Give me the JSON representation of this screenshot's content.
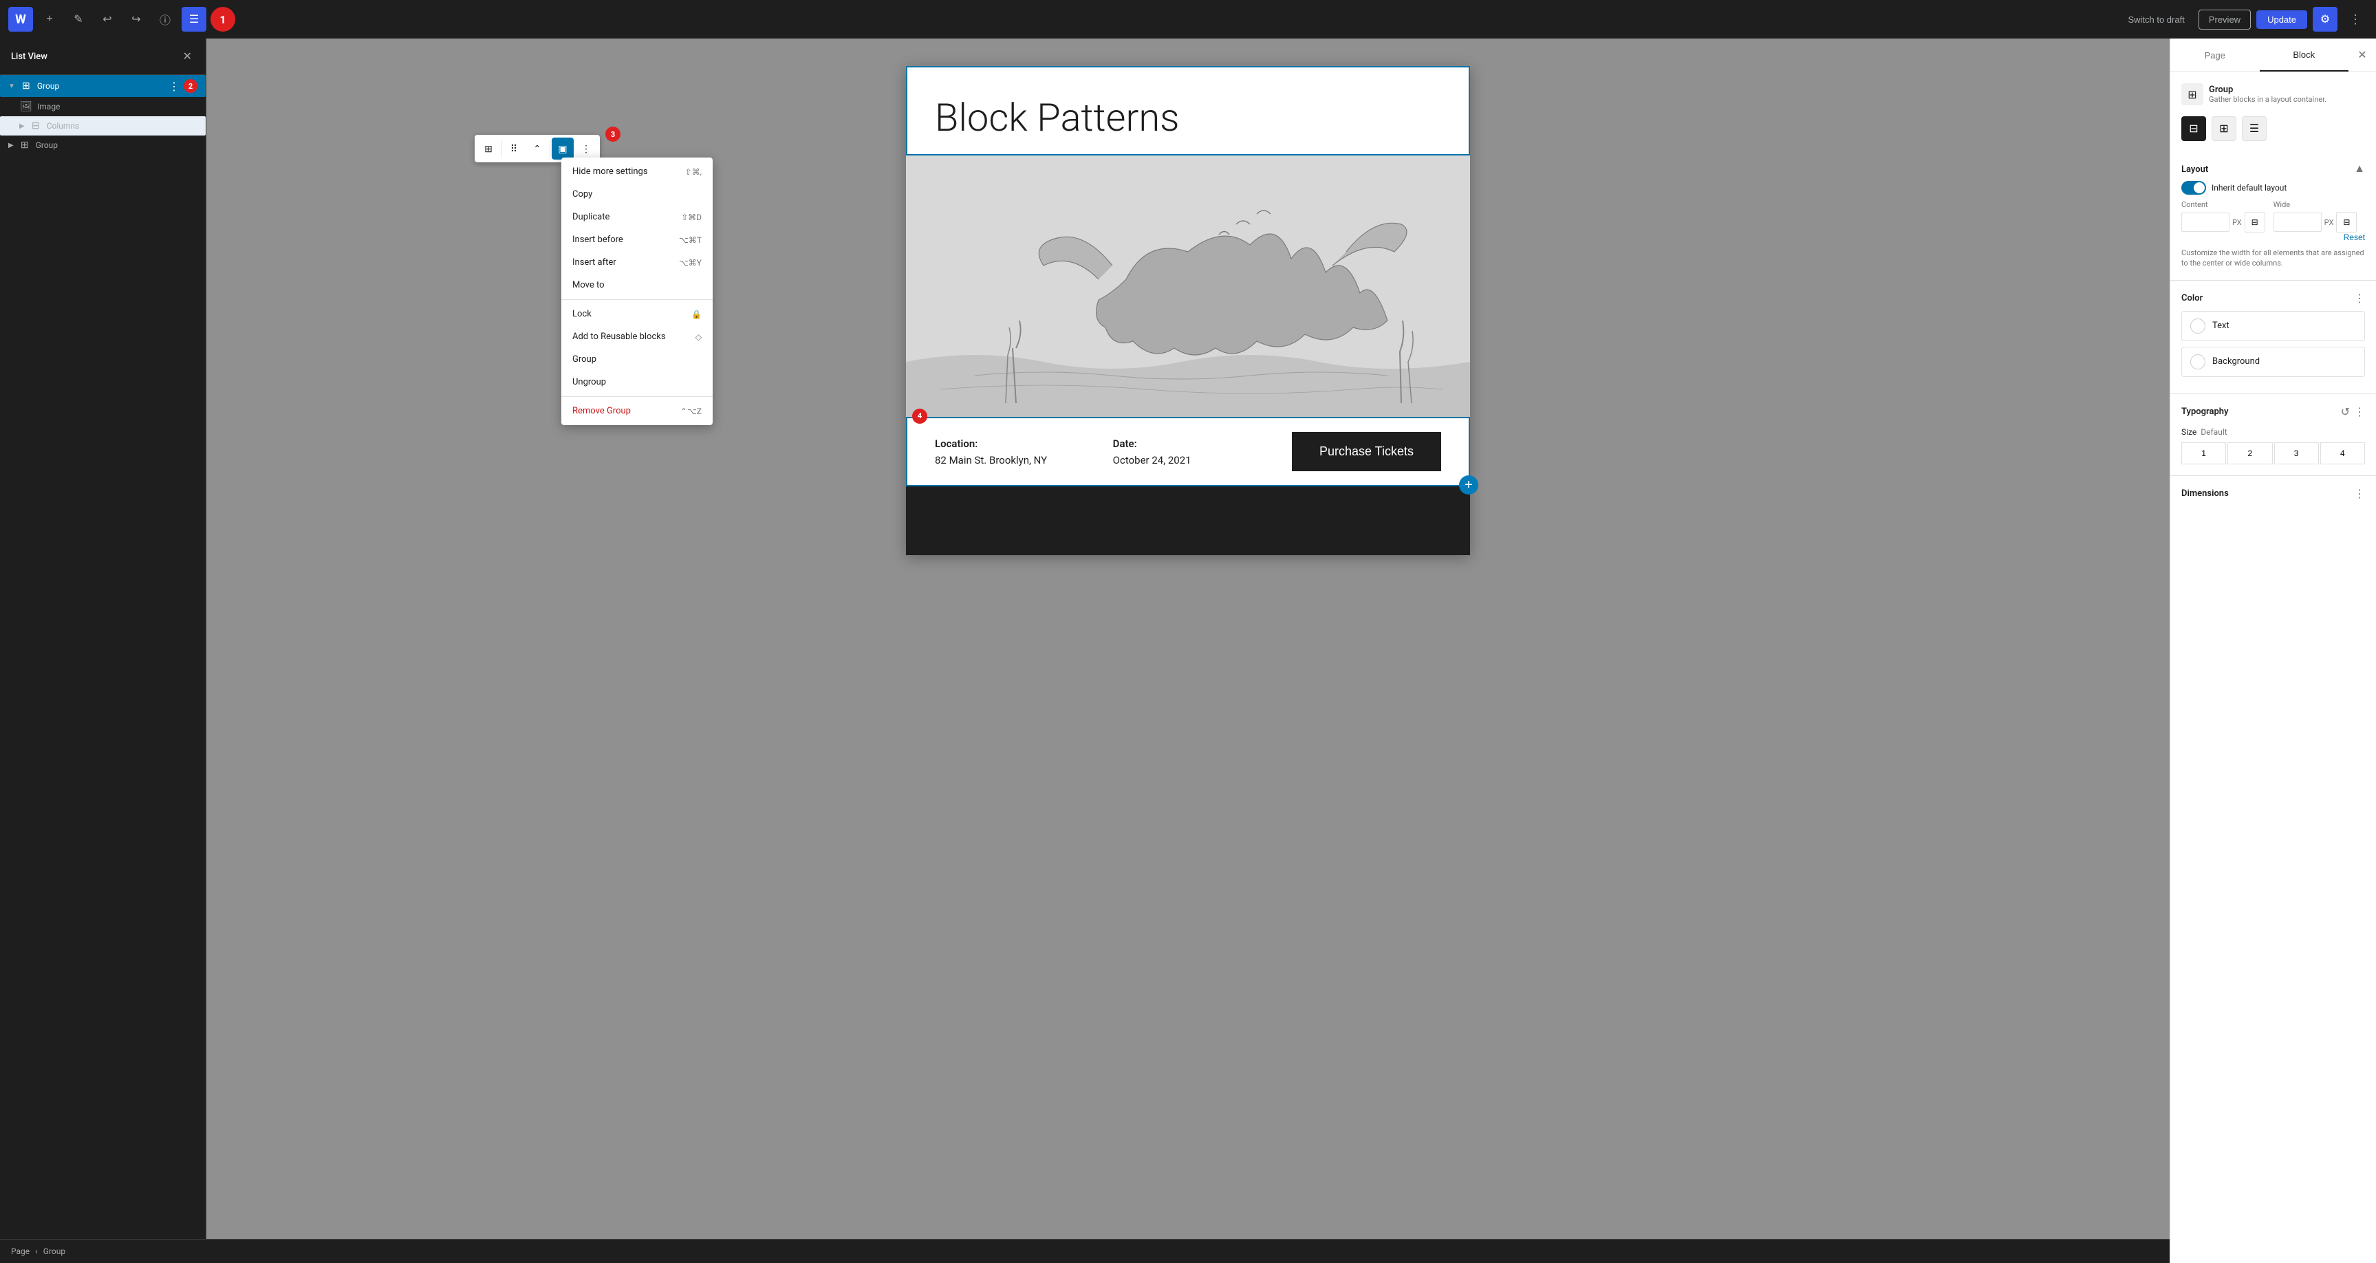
{
  "topbar": {
    "logo": "W",
    "switch_draft": "Switch to draft",
    "preview": "Preview",
    "update": "Update",
    "tools": [
      "+",
      "✏",
      "↩",
      "↪",
      "ⓘ",
      "≡"
    ]
  },
  "sidebar": {
    "title": "List View",
    "items": [
      {
        "id": "group",
        "label": "Group",
        "level": 0,
        "selected": true,
        "hasChevron": true,
        "icon": "⊞"
      },
      {
        "id": "image",
        "label": "Image",
        "level": 1,
        "selected": false,
        "icon": "🖼"
      },
      {
        "id": "columns",
        "label": "Columns",
        "level": 1,
        "selected": false,
        "icon": "⊟",
        "hasChevron": true
      },
      {
        "id": "group2",
        "label": "Group",
        "level": 0,
        "selected": false,
        "icon": "⊞",
        "hasChevron": true
      }
    ],
    "badge2": "2",
    "badge3": "3",
    "badge4": "4"
  },
  "context_menu": {
    "items": [
      {
        "id": "hide-settings",
        "label": "Hide more settings",
        "shortcut": "⇧⌘,",
        "destructive": false
      },
      {
        "id": "copy",
        "label": "Copy",
        "shortcut": "",
        "destructive": false
      },
      {
        "id": "duplicate",
        "label": "Duplicate",
        "shortcut": "⇧⌘D",
        "destructive": false
      },
      {
        "id": "insert-before",
        "label": "Insert before",
        "shortcut": "⌥⌘T",
        "destructive": false
      },
      {
        "id": "insert-after",
        "label": "Insert after",
        "shortcut": "⌥⌘Y",
        "destructive": false
      },
      {
        "id": "move-to",
        "label": "Move to",
        "shortcut": "",
        "destructive": false
      },
      {
        "id": "lock",
        "label": "Lock",
        "shortcut": "🔒",
        "destructive": false
      },
      {
        "id": "add-reusable",
        "label": "Add to Reusable blocks",
        "shortcut": "◇",
        "destructive": false
      },
      {
        "id": "group-items",
        "label": "Group",
        "shortcut": "",
        "destructive": false
      },
      {
        "id": "ungroup",
        "label": "Ungroup",
        "shortcut": "",
        "destructive": false
      },
      {
        "id": "remove-group",
        "label": "Remove Group",
        "shortcut": "⌃⌥Z",
        "destructive": true
      }
    ]
  },
  "page": {
    "title": "Block Patterns",
    "location_label": "Location:",
    "location_value": "82 Main St. Brooklyn, NY",
    "date_label": "Date:",
    "date_value": "October 24, 2021",
    "purchase_btn": "Purchase Tickets"
  },
  "right_sidebar": {
    "tabs": [
      "Page",
      "Block"
    ],
    "active_tab": "Block",
    "group_name": "Group",
    "group_desc": "Gather blocks in a layout container.",
    "layout_section": "Layout",
    "inherit_layout": "Inherit default layout",
    "content_label": "Content",
    "wide_label": "Wide",
    "content_value": "",
    "wide_value": "",
    "unit": "PX",
    "reset_btn": "Reset",
    "layout_desc": "Customize the width for all elements that are assigned to the center or wide columns.",
    "color_section": "Color",
    "text_label": "Text",
    "background_label": "Background",
    "typography_section": "Typography",
    "size_label": "Size",
    "size_default": "Default",
    "size_presets": [
      "1",
      "2",
      "3",
      "4"
    ],
    "dimensions_section": "Dimensions"
  },
  "breadcrumb": {
    "items": [
      "Page",
      "Group"
    ]
  },
  "badges": {
    "b1": "1",
    "b2": "2",
    "b3": "3",
    "b4": "4"
  }
}
